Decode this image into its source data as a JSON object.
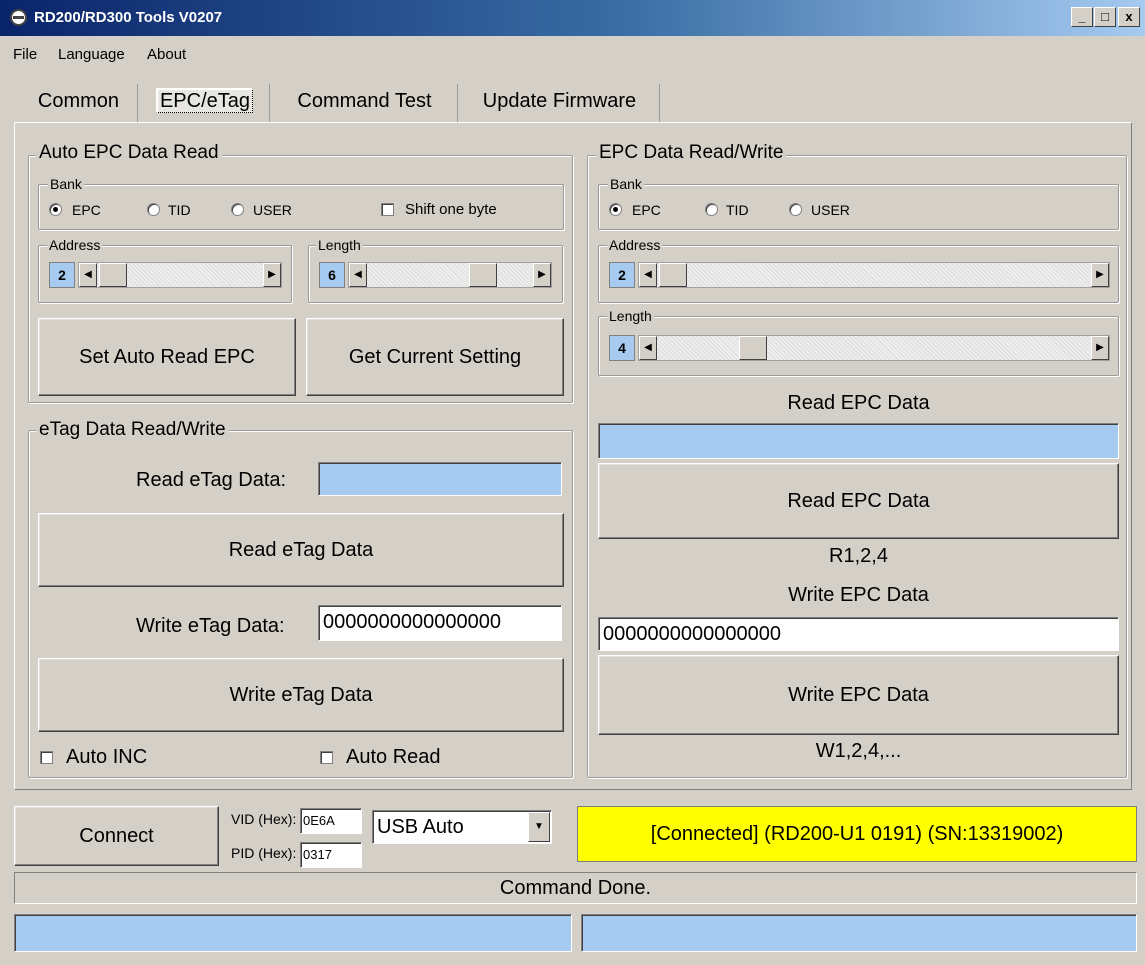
{
  "window": {
    "title": "RD200/RD300 Tools V0207",
    "min_symbol": "_",
    "max_symbol": "□",
    "close_symbol": "x"
  },
  "menu": [
    "File",
    "Language",
    "About"
  ],
  "tabs": [
    "Common",
    "EPC/eTag",
    "Command Test",
    "Update Firmware"
  ],
  "active_tab": "EPC/eTag",
  "auto_epc": {
    "title": "Auto EPC Data Read",
    "bank_title": "Bank",
    "bank_options": [
      "EPC",
      "TID",
      "USER"
    ],
    "bank_selected": "EPC",
    "shift_label": "Shift one byte",
    "address_title": "Address",
    "address_value": "2",
    "length_title": "Length",
    "length_value": "6",
    "set_button": "Set Auto Read EPC",
    "get_button": "Get Current Setting"
  },
  "etag": {
    "title": "eTag Data Read/Write",
    "read_label": "Read eTag Data:",
    "read_value": "",
    "read_button": "Read eTag Data",
    "write_label": "Write eTag Data:",
    "write_value": "0000000000000000",
    "write_button": "Write eTag Data",
    "auto_inc_label": "Auto INC",
    "auto_read_label": "Auto Read"
  },
  "epc_rw": {
    "title": "EPC Data Read/Write",
    "bank_title": "Bank",
    "bank_options": [
      "EPC",
      "TID",
      "USER"
    ],
    "bank_selected": "EPC",
    "address_title": "Address",
    "address_value": "2",
    "length_title": "Length",
    "length_value": "4",
    "read_heading": "Read EPC Data",
    "read_value": "",
    "read_button": "Read EPC Data",
    "read_cmd": "R1,2,4",
    "write_heading": "Write EPC Data",
    "write_value": "0000000000000000",
    "write_button": "Write EPC Data",
    "write_cmd": "W1,2,4,..."
  },
  "bottom": {
    "connect_button": "Connect",
    "vid_label": "VID (Hex):",
    "vid_value": "0E6A",
    "pid_label": "PID (Hex):",
    "pid_value": "0317",
    "mode_selected": "USB Auto",
    "connection_status": "[Connected] (RD200-U1     0191) (SN:13319002)",
    "status_message": "Command Done."
  },
  "colors": {
    "field_blue": "#a6caf0",
    "status_yellow": "#ffff00",
    "window_bg": "#d4d0c8"
  }
}
